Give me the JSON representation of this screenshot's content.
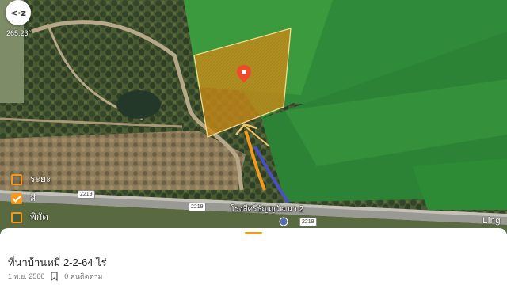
{
  "map": {
    "compass_label": "<·z",
    "heading": "265.23°",
    "road_name": "โรงสีศรีธัญญวัฒนา 2",
    "road_number": "2219",
    "watermark": "Ling",
    "layers": [
      {
        "label": "ระยะ",
        "checked": false
      },
      {
        "label": "สี",
        "checked": true
      },
      {
        "label": "พิกัด",
        "checked": false
      }
    ],
    "colors": {
      "parcel_fill": "#c98a18",
      "parcel_border": "#f3dc8c",
      "pin": "#f04a2a",
      "accent": "#f39a1e",
      "route_blue": "#4b4fc4"
    }
  },
  "listing": {
    "title": "ที่นาบ้านหมี่ 2-2-64 ไร่",
    "date": "1 พ.ย. 2566",
    "followers": "0 คนติดตาม"
  }
}
